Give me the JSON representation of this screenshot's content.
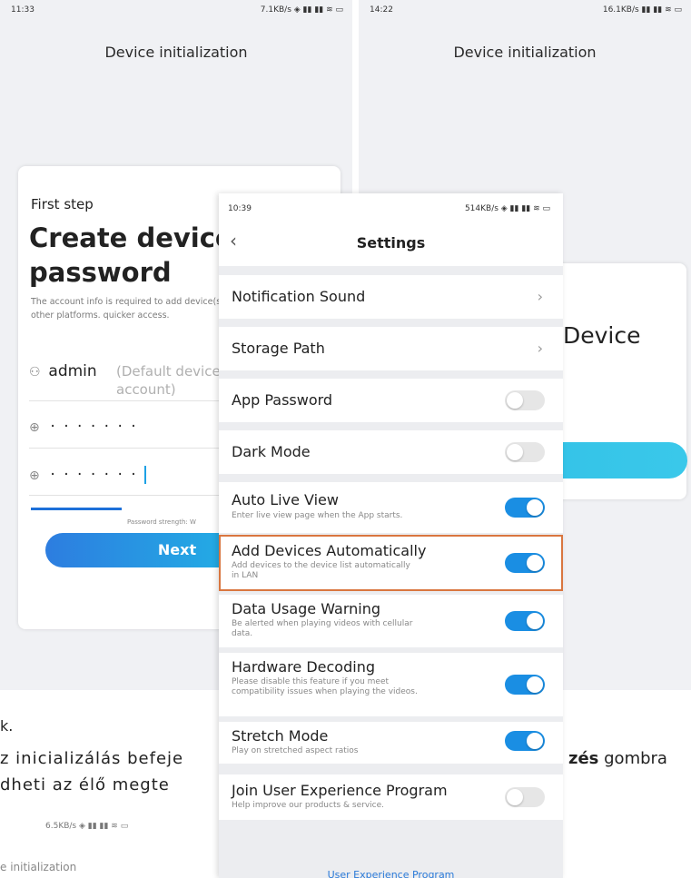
{
  "left_phone": {
    "status_time": "11:33",
    "status_right": "7.1KB/s ◈ ▮▮ ▮▮ ≋ ▭",
    "title": "Device initialization",
    "step": "First step",
    "heading1": "Create device",
    "heading2": "password",
    "info": "The account info is required to add device(s) on other platforms. quicker access.",
    "username": "admin",
    "username_hint": "(Default device account)",
    "password1": "· · · · · · ·",
    "password2": "· · · · · · ·",
    "strength": "Password strength: W",
    "next_label": "Next"
  },
  "right_phone": {
    "status_time": "14:22",
    "status_right": "16.1KB/s ▮▮ ▮▮ ≋ ▭",
    "title": "Device initialization",
    "word": "Device"
  },
  "settings": {
    "status_time": "10:39",
    "status_right": "514KB/s ◈ ▮▮ ▮▮ ≋ ▭",
    "title": "Settings",
    "rows": [
      {
        "label": "Notification Sound",
        "desc": "",
        "control": "chevron"
      },
      {
        "label": "Storage Path",
        "desc": "",
        "control": "chevron"
      },
      {
        "label": "App Password",
        "desc": "",
        "control": "off"
      },
      {
        "label": "Dark Mode",
        "desc": "",
        "control": "off"
      },
      {
        "label": "Auto Live View",
        "desc": "Enter live view page when the App starts.",
        "control": "on"
      },
      {
        "label": "Add Devices Automatically",
        "desc": "Add devices to the device list automatically in LAN",
        "control": "on"
      },
      {
        "label": "Data Usage Warning",
        "desc": "Be alerted when playing videos with cellular data.",
        "control": "on"
      },
      {
        "label": "Hardware Decoding",
        "desc": "Please disable this feature if you meet compatibility issues when playing the videos.",
        "control": "on"
      },
      {
        "label": "Stretch Mode",
        "desc": "Play on stretched aspect ratios",
        "control": "on"
      },
      {
        "label": "Join User Experience Program",
        "desc": "Help improve our products & service.",
        "control": "off"
      }
    ],
    "link": "User Experience Program"
  },
  "background_text": {
    "line_k": "k.",
    "line1_left": "z inicializálás befeje",
    "line1_bold": "zés",
    "line1_right": " gombra",
    "line2_left": "dheti az élő megte",
    "bottom_status": "6.5KB/s ◈ ▮▮ ▮▮ ≋ ▭",
    "bottom_title": "e initialization"
  },
  "colors": {
    "accent": "#1a8ee3",
    "highlight": "#d9763f",
    "link": "#2a7ad8"
  }
}
